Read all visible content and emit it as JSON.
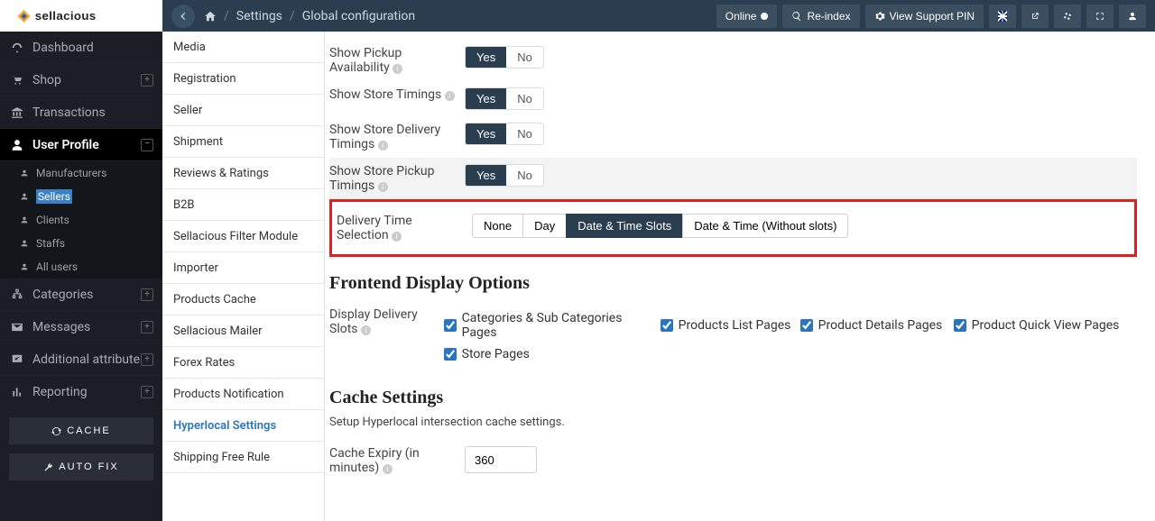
{
  "header": {
    "breadcrumb_settings": "Settings",
    "breadcrumb_page": "Global configuration",
    "online": "Online",
    "reindex": "Re-index",
    "view_pin": "View Support PIN"
  },
  "sidebar": {
    "dashboard": "Dashboard",
    "shop": "Shop",
    "transactions": "Transactions",
    "user_profile": "User Profile",
    "sub": {
      "manufacturers": "Manufacturers",
      "sellers": "Sellers",
      "clients": "Clients",
      "staffs": "Staffs",
      "all_users": "All users"
    },
    "categories": "Categories",
    "messages": "Messages",
    "additional_attribute": "Additional attribute",
    "reporting": "Reporting",
    "cache_btn": "CACHE",
    "autofix_btn": "AUTO FIX"
  },
  "tabs": {
    "media": "Media",
    "registration": "Registration",
    "seller": "Seller",
    "shipment": "Shipment",
    "reviews": "Reviews & Ratings",
    "b2b": "B2B",
    "filter_module": "Sellacious Filter Module",
    "importer": "Importer",
    "products_cache": "Products Cache",
    "sellacious_mailer": "Sellacious Mailer",
    "forex_rates": "Forex Rates",
    "products_notification": "Products Notification",
    "hyperlocal": "Hyperlocal Settings",
    "shipping_free": "Shipping Free Rule"
  },
  "fields": {
    "availability_tail": "Availability",
    "show_pickup": "Show Pickup Availability",
    "show_store_timings": "Show Store Timings",
    "show_delivery_timings": "Show Store Delivery Timings",
    "show_pickup_timings": "Show Store Pickup Timings",
    "delivery_time_selection": "Delivery Time Selection",
    "yes": "Yes",
    "no": "No",
    "dts_options": {
      "none": "None",
      "day": "Day",
      "date_time_slots": "Date & Time Slots",
      "date_time_no_slots": "Date & Time (Without slots)"
    }
  },
  "frontend": {
    "title": "Frontend Display Options",
    "display_delivery_slots": "Display Delivery Slots",
    "cat_pages": "Categories & Sub Categories Pages",
    "products_list": "Products List Pages",
    "product_details": "Product Details Pages",
    "quick_view": "Product Quick View Pages",
    "store_pages": "Store Pages"
  },
  "cache": {
    "title": "Cache Settings",
    "desc": "Setup Hyperlocal intersection cache settings.",
    "expiry_label": "Cache Expiry (in minutes)",
    "expiry_value": "360"
  }
}
